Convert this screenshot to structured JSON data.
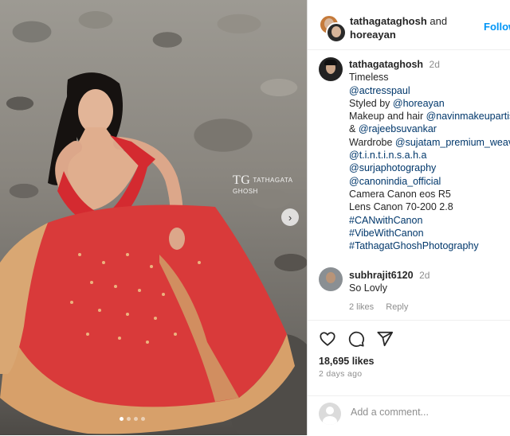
{
  "header": {
    "user1": "tathagataghosh",
    "and_text": "and",
    "user2": "horeayan",
    "follow_label": "Follow"
  },
  "media": {
    "watermark_mono": "TG",
    "watermark_text": "TATHAGATA GHOSH",
    "slide_count": 4,
    "active_slide": 1
  },
  "caption": {
    "username": "tathagataghosh",
    "time": "2d",
    "lines": [
      {
        "text": "Timeless",
        "tag": false
      },
      {
        "text": "@actresspaul",
        "tag": true
      },
      {
        "pre": "Styled by ",
        "text": "@horeayan",
        "tag": true
      },
      {
        "pre": "Makeup and hair ",
        "text": "@navinmakeupartist",
        "tag": true
      },
      {
        "pre": "& ",
        "text": "@rajeebsuvankar",
        "tag": true
      },
      {
        "pre": "Wardrobe ",
        "text": "@sujatam_premium_weaves",
        "tag": true
      },
      {
        "text": "@t.i.n.t.i.n.s.a.h.a",
        "tag": true
      },
      {
        "text": "@surjaphotography",
        "tag": true
      },
      {
        "text": "@canonindia_official",
        "tag": true
      },
      {
        "text": "Camera Canon eos R5",
        "tag": false
      },
      {
        "text": "Lens Canon 70-200 2.8",
        "tag": false
      },
      {
        "text": "#CANwithCanon",
        "tag": true
      },
      {
        "text": "#VibeWithCanon",
        "tag": true
      },
      {
        "text": "#TathagatGhoshPhotography",
        "tag": true
      }
    ]
  },
  "comment": {
    "username": "subhrajit6120",
    "time": "2d",
    "text": "So Lovly",
    "likes": "2 likes",
    "reply": "Reply"
  },
  "actions": {
    "likes": "18,695 likes",
    "time_ago": "2 days ago",
    "add_comment_placeholder": "Add a comment..."
  },
  "colors": {
    "link": "#00376b",
    "follow": "#0095f6",
    "muted": "#8e8e8e"
  }
}
